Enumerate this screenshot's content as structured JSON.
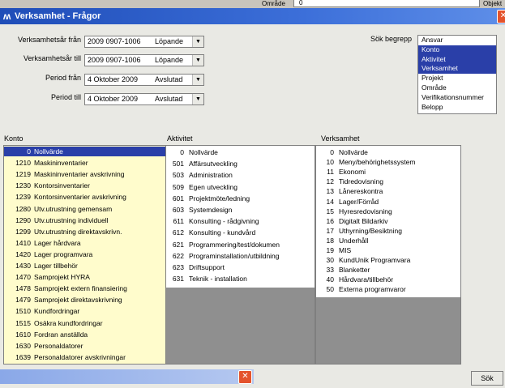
{
  "topbar": {
    "cells": [
      {
        "label": "Område",
        "value": "0"
      },
      {
        "label": "Objekt",
        "value": ""
      }
    ]
  },
  "window": {
    "title": "Verksamhet - Frågor",
    "close_glyph": "✕"
  },
  "filters": [
    {
      "label": "Verksamhetsår från",
      "value": "2009 0907-1006",
      "status": "Löpande"
    },
    {
      "label": "Verksamhetsår till",
      "value": "2009 0907-1006",
      "status": "Löpande"
    },
    {
      "label": "Period från",
      "value": "4 Oktober 2009",
      "status": "Avslutad"
    },
    {
      "label": "Period till",
      "value": "4 Oktober 2009",
      "status": "Avslutad"
    }
  ],
  "search_terms": {
    "label": "Sök begrepp",
    "items": [
      {
        "label": "Ansvar",
        "selected": false
      },
      {
        "label": "Konto",
        "selected": true
      },
      {
        "label": "Aktivitet",
        "selected": true
      },
      {
        "label": "Verksamhet",
        "selected": true
      },
      {
        "label": "Projekt",
        "selected": false
      },
      {
        "label": "Område",
        "selected": false
      },
      {
        "label": "Verifikationsnummer",
        "selected": false
      },
      {
        "label": "Belopp",
        "selected": false
      }
    ]
  },
  "konto": {
    "label": "Konto",
    "rows": [
      {
        "code": "0",
        "name": "Nollvärde",
        "selected": true
      },
      {
        "code": "1210",
        "name": "Maskininventarier"
      },
      {
        "code": "1219",
        "name": "Maskininventarier avskrivning"
      },
      {
        "code": "1230",
        "name": "Kontorsinventarier"
      },
      {
        "code": "1239",
        "name": "Kontorsinventarier avskrivning"
      },
      {
        "code": "1280",
        "name": "Utv.utrustning gemensam"
      },
      {
        "code": "1290",
        "name": "Utv.utrustning individuell"
      },
      {
        "code": "1299",
        "name": "Utv.utrustning direktavskrivn."
      },
      {
        "code": "1410",
        "name": "Lager hårdvara"
      },
      {
        "code": "1420",
        "name": "Lager programvara"
      },
      {
        "code": "1430",
        "name": "Lager tillbehör"
      },
      {
        "code": "1470",
        "name": "Samprojekt HYRA"
      },
      {
        "code": "1478",
        "name": "Samprojekt extern finansiering"
      },
      {
        "code": "1479",
        "name": "Samprojekt direktavskrivning"
      },
      {
        "code": "1510",
        "name": "Kundfordringar"
      },
      {
        "code": "1515",
        "name": "Osäkra kundfordringar"
      },
      {
        "code": "1610",
        "name": "Fordran anställda"
      },
      {
        "code": "1630",
        "name": "Personaldatorer"
      },
      {
        "code": "1639",
        "name": "Personaldatorer avskrivningar"
      }
    ]
  },
  "aktivitet": {
    "label": "Aktivitet",
    "rows": [
      {
        "code": "0",
        "name": "Nollvärde"
      },
      {
        "code": "501",
        "name": "Affärsutveckling"
      },
      {
        "code": "503",
        "name": "Administration"
      },
      {
        "code": "509",
        "name": "Egen utveckling"
      },
      {
        "code": "601",
        "name": "Projektmöte/ledning"
      },
      {
        "code": "603",
        "name": "Systemdesign"
      },
      {
        "code": "611",
        "name": "Konsulting - rådgivning"
      },
      {
        "code": "612",
        "name": "Konsulting - kundvård"
      },
      {
        "code": "621",
        "name": "Programmering/test/dokumen"
      },
      {
        "code": "622",
        "name": "Programinstallation/utbildning"
      },
      {
        "code": "623",
        "name": "Driftsupport"
      },
      {
        "code": "631",
        "name": "Teknik - installation"
      }
    ]
  },
  "verksamhet": {
    "label": "Verksamhet",
    "rows": [
      {
        "code": "0",
        "name": "Nollvärde"
      },
      {
        "code": "10",
        "name": "Meny/behörighetssystem"
      },
      {
        "code": "11",
        "name": "Ekonomi"
      },
      {
        "code": "12",
        "name": "Tidredovisning"
      },
      {
        "code": "13",
        "name": "Lånereskontra"
      },
      {
        "code": "14",
        "name": "Lager/Förråd"
      },
      {
        "code": "15",
        "name": "Hyresredovisning"
      },
      {
        "code": "16",
        "name": "Digitalt Bildarkiv"
      },
      {
        "code": "17",
        "name": "Uthyrning/Besiktning"
      },
      {
        "code": "18",
        "name": "Underhåll"
      },
      {
        "code": "19",
        "name": "MIS"
      },
      {
        "code": "30",
        "name": "KundUnik Programvara"
      },
      {
        "code": "33",
        "name": "Blanketter"
      },
      {
        "code": "40",
        "name": "Hårdvara/tillbehör"
      },
      {
        "code": "50",
        "name": "Externa programvaror"
      }
    ]
  },
  "actions": {
    "search_label": "Sök"
  },
  "subwindow": {
    "close_glyph": "✕"
  }
}
